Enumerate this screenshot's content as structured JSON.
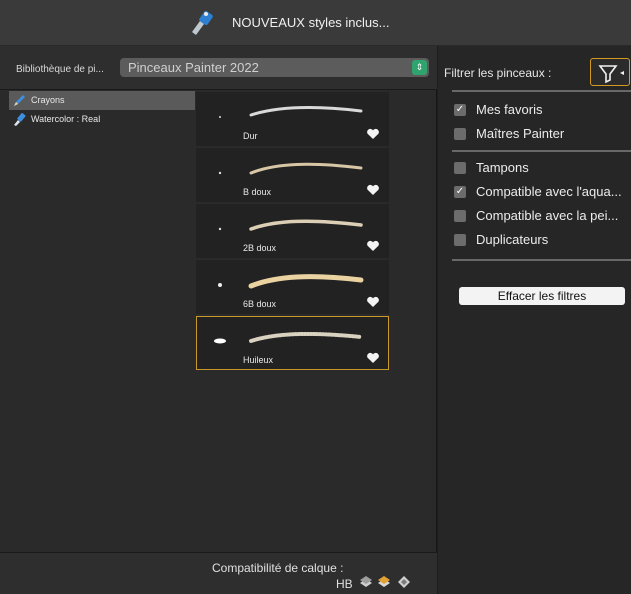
{
  "header": {
    "title": "NOUVEAUX styles inclus..."
  },
  "library": {
    "label": "Bibliothèque de pi...",
    "selected": "Pinceaux Painter 2022"
  },
  "categories": [
    {
      "label": "Crayons",
      "selected": true
    },
    {
      "label": "Watercolor : Real",
      "selected": false
    }
  ],
  "brushes": [
    {
      "name": "Dur",
      "selected": false
    },
    {
      "name": "B doux",
      "selected": false
    },
    {
      "name": "2B doux",
      "selected": false
    },
    {
      "name": "6B doux",
      "selected": false
    },
    {
      "name": "Huileux",
      "selected": true
    }
  ],
  "compat": {
    "title": "Compatibilité de calque :",
    "value": "HB"
  },
  "filters": {
    "title": "Filtrer les pinceaux :",
    "options": [
      {
        "label": "Mes favoris",
        "checked": true
      },
      {
        "label": "Maîtres Painter",
        "checked": false
      },
      {
        "label": "Tampons",
        "checked": false
      },
      {
        "label": "Compatible avec l'aqua...",
        "checked": true
      },
      {
        "label": "Compatible avec la pei...",
        "checked": false
      },
      {
        "label": "Duplicateurs",
        "checked": false
      }
    ],
    "clear_label": "Effacer les filtres"
  },
  "colors": {
    "accent": "#d59a24",
    "selected_border": "#c99a2a",
    "select_arrow": "#2fa46e"
  }
}
